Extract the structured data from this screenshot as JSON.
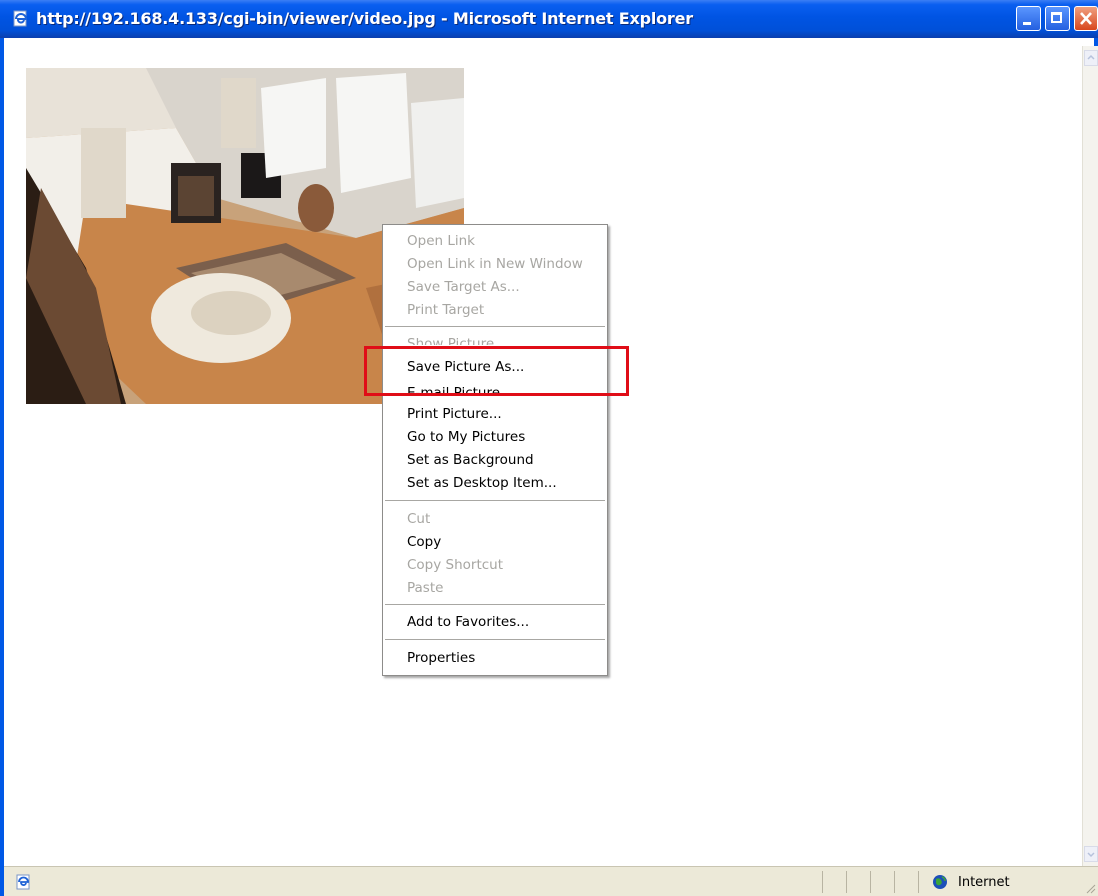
{
  "window": {
    "title": "http://192.168.4.133/cgi-bin/viewer/video.jpg - Microsoft Internet Explorer"
  },
  "content": {
    "image_alt_icon": "camera-snapshot-living-room"
  },
  "context_menu": {
    "items": [
      {
        "label": "Open Link",
        "enabled": false
      },
      {
        "label": "Open Link in New Window",
        "enabled": false
      },
      {
        "label": "Save Target As...",
        "enabled": false
      },
      {
        "label": "Print Target",
        "enabled": false
      },
      {
        "label": "Show Picture",
        "enabled": false
      },
      {
        "label": "Save Picture As...",
        "enabled": true
      },
      {
        "label": "E-mail Picture...",
        "enabled": true
      },
      {
        "label": "Print Picture...",
        "enabled": true
      },
      {
        "label": "Go to My Pictures",
        "enabled": true
      },
      {
        "label": "Set as Background",
        "enabled": true
      },
      {
        "label": "Set as Desktop Item...",
        "enabled": true
      },
      {
        "label": "Cut",
        "enabled": false
      },
      {
        "label": "Copy",
        "enabled": true
      },
      {
        "label": "Copy Shortcut",
        "enabled": false
      },
      {
        "label": "Paste",
        "enabled": false
      },
      {
        "label": "Add to Favorites...",
        "enabled": true
      },
      {
        "label": "Properties",
        "enabled": true
      }
    ],
    "highlighted_item": "Save Picture As...",
    "highlight_color": "#e00d17"
  },
  "status_bar": {
    "zone": "Internet"
  },
  "colors": {
    "titlebar": "#0054e3",
    "menu_disabled": "#a7a6a2",
    "status_bg": "#ece9d8"
  }
}
